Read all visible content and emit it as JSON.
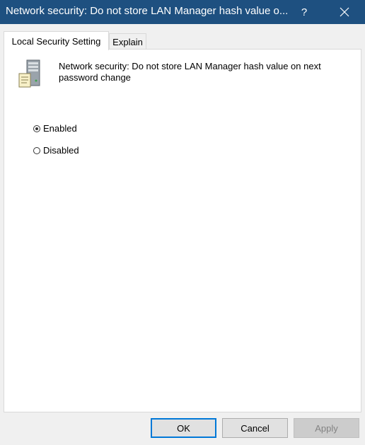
{
  "window": {
    "title": "Network security: Do not store LAN Manager hash value o...",
    "help_label": "?",
    "titlebar_color": "#1e5080"
  },
  "tabs": [
    {
      "label": "Local Security Setting",
      "active": true
    },
    {
      "label": "Explain",
      "active": false
    }
  ],
  "policy": {
    "icon": "server-document-icon",
    "title": "Network security: Do not store LAN Manager hash value on next password change"
  },
  "options": [
    {
      "label": "Enabled",
      "selected": true
    },
    {
      "label": "Disabled",
      "selected": false
    }
  ],
  "buttons": {
    "ok": "OK",
    "cancel": "Cancel",
    "apply": "Apply"
  }
}
